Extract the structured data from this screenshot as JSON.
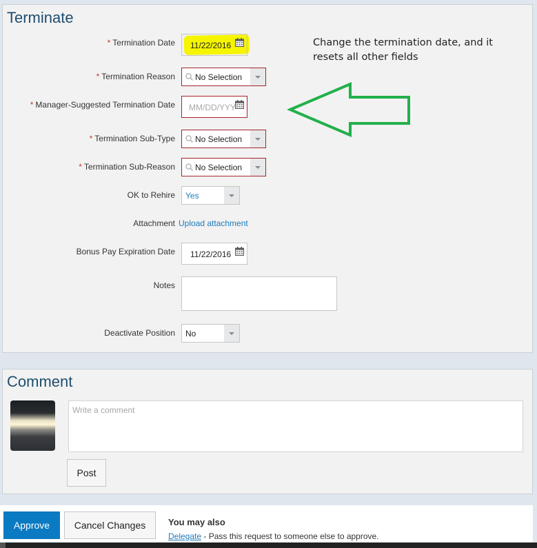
{
  "terminate": {
    "title": "Terminate",
    "fields": {
      "termination_date": {
        "label": "Termination Date",
        "required": true,
        "value": "11/22/2016",
        "highlighted": true
      },
      "termination_reason": {
        "label": "Termination Reason",
        "required": true,
        "value": "No Selection"
      },
      "manager_suggested_date": {
        "label": "Manager-Suggested Termination Date",
        "required": true,
        "placeholder": "MM/DD/YYYY",
        "display": "MM/DD/YYY"
      },
      "termination_sub_type": {
        "label": "Termination Sub-Type",
        "required": true,
        "value": "No Selection"
      },
      "termination_sub_reason": {
        "label": "Termination Sub-Reason",
        "required": true,
        "value": "No Selection"
      },
      "ok_to_rehire": {
        "label": "OK to Rehire",
        "value": "Yes"
      },
      "attachment": {
        "label": "Attachment",
        "link": "Upload attachment"
      },
      "bonus_pay_expiration": {
        "label": "Bonus Pay Expiration Date",
        "value": "11/22/2016"
      },
      "notes": {
        "label": "Notes",
        "value": ""
      },
      "deactivate_position": {
        "label": "Deactivate Position",
        "value": "No"
      }
    },
    "required_marker": "*"
  },
  "annotation": {
    "text": "Change the termination date, and it resets all other fields",
    "arrow_color": "#22b04b",
    "highlight_color": "#f5f500"
  },
  "comment": {
    "title": "Comment",
    "placeholder": "Write a comment",
    "post_label": "Post"
  },
  "footer": {
    "approve_label": "Approve",
    "cancel_label": "Cancel Changes",
    "you_may_also": "You may also",
    "delegate_link": "Delegate",
    "delegate_text": " - Pass this request to someone else to approve."
  },
  "colors": {
    "accent": "#0a7ac2",
    "title": "#1f4e6e",
    "error_border": "#a4232a",
    "link": "#1e7bb8"
  }
}
